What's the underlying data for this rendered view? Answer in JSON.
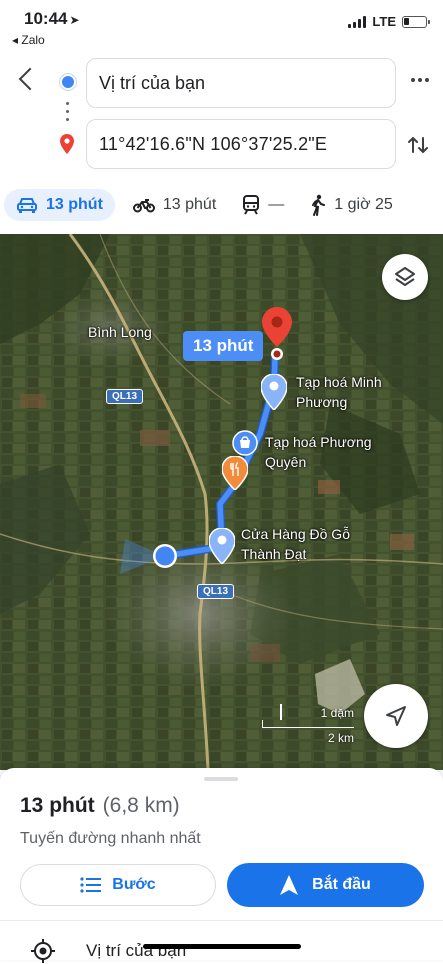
{
  "status_bar": {
    "time": "10:44",
    "back_app": "◂ Zalo",
    "network": "LTE"
  },
  "directions": {
    "origin_value": "Vị trí của bạn",
    "destination_value": "11°42'16.6\"N 106°37'25.2\"E"
  },
  "modes": [
    {
      "name": "car",
      "label": "13 phút",
      "selected": true
    },
    {
      "name": "motorbike",
      "label": "13 phút"
    },
    {
      "name": "transit",
      "label": "—"
    },
    {
      "name": "walk",
      "label": "1 giờ 25"
    }
  ],
  "map": {
    "eta_bubble": "13 phút",
    "labels": {
      "city": "Bình Long",
      "place_1": "Tạp hoá Minh Phương",
      "place_1_line1": "Tạp hoá Minh",
      "place_1_line2": "Phương",
      "place_2": "Tạp hoá Phương Quyên",
      "place_2_line1": "Tạp hoá Phương",
      "place_2_line2": "Quyên",
      "place_3": "Cửa Hàng Đồ Gỗ Thành Đạt",
      "place_3_line1": "Cửa Hàng Đồ Gỗ",
      "place_3_line2": "Thành Đạt"
    },
    "road_badges": [
      "QL13",
      "QL13"
    ],
    "scale": {
      "imperial": "1 dặm",
      "metric": "2 km"
    },
    "colors": {
      "route": "#4c8df6",
      "pin": "#ea4335",
      "accent": "#1a73e8"
    }
  },
  "sheet": {
    "duration": "13 phút",
    "distance": "(6,8 km)",
    "subtitle": "Tuyến đường nhanh nhất",
    "steps_button": "Bước",
    "start_button": "Bắt đầu",
    "next_row_label": "Vị trí của bạn"
  }
}
